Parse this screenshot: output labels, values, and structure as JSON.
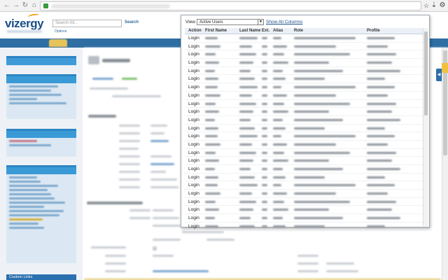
{
  "browser": {
    "back_icon": "arrow-left-icon",
    "forward_icon": "arrow-right-icon",
    "reload_icon": "reload-icon",
    "home_icon": "home-icon",
    "bookmark_icon": "star-icon",
    "extension_icon": "download-icon",
    "menu_icon": "wrench-icon"
  },
  "header": {
    "logo_text": "vizergy",
    "search_placeholder": "Search All...",
    "search_button": "Search",
    "options_link": "Options"
  },
  "popup": {
    "view_label": "View",
    "view_selected": "Active Users",
    "show_all_link": "Show All Columns",
    "columns": [
      "Action",
      "First Name",
      "Last Name",
      "Ext.",
      "Alias",
      "Role",
      "Profile"
    ],
    "row_action": "Login",
    "row_count": 24
  },
  "sidebar": {
    "bottom_label": "Custom Links"
  },
  "colors": {
    "brand_blue": "#2f6ea3",
    "active_tab": "#e7c45a",
    "link": "#1d4e8a"
  }
}
